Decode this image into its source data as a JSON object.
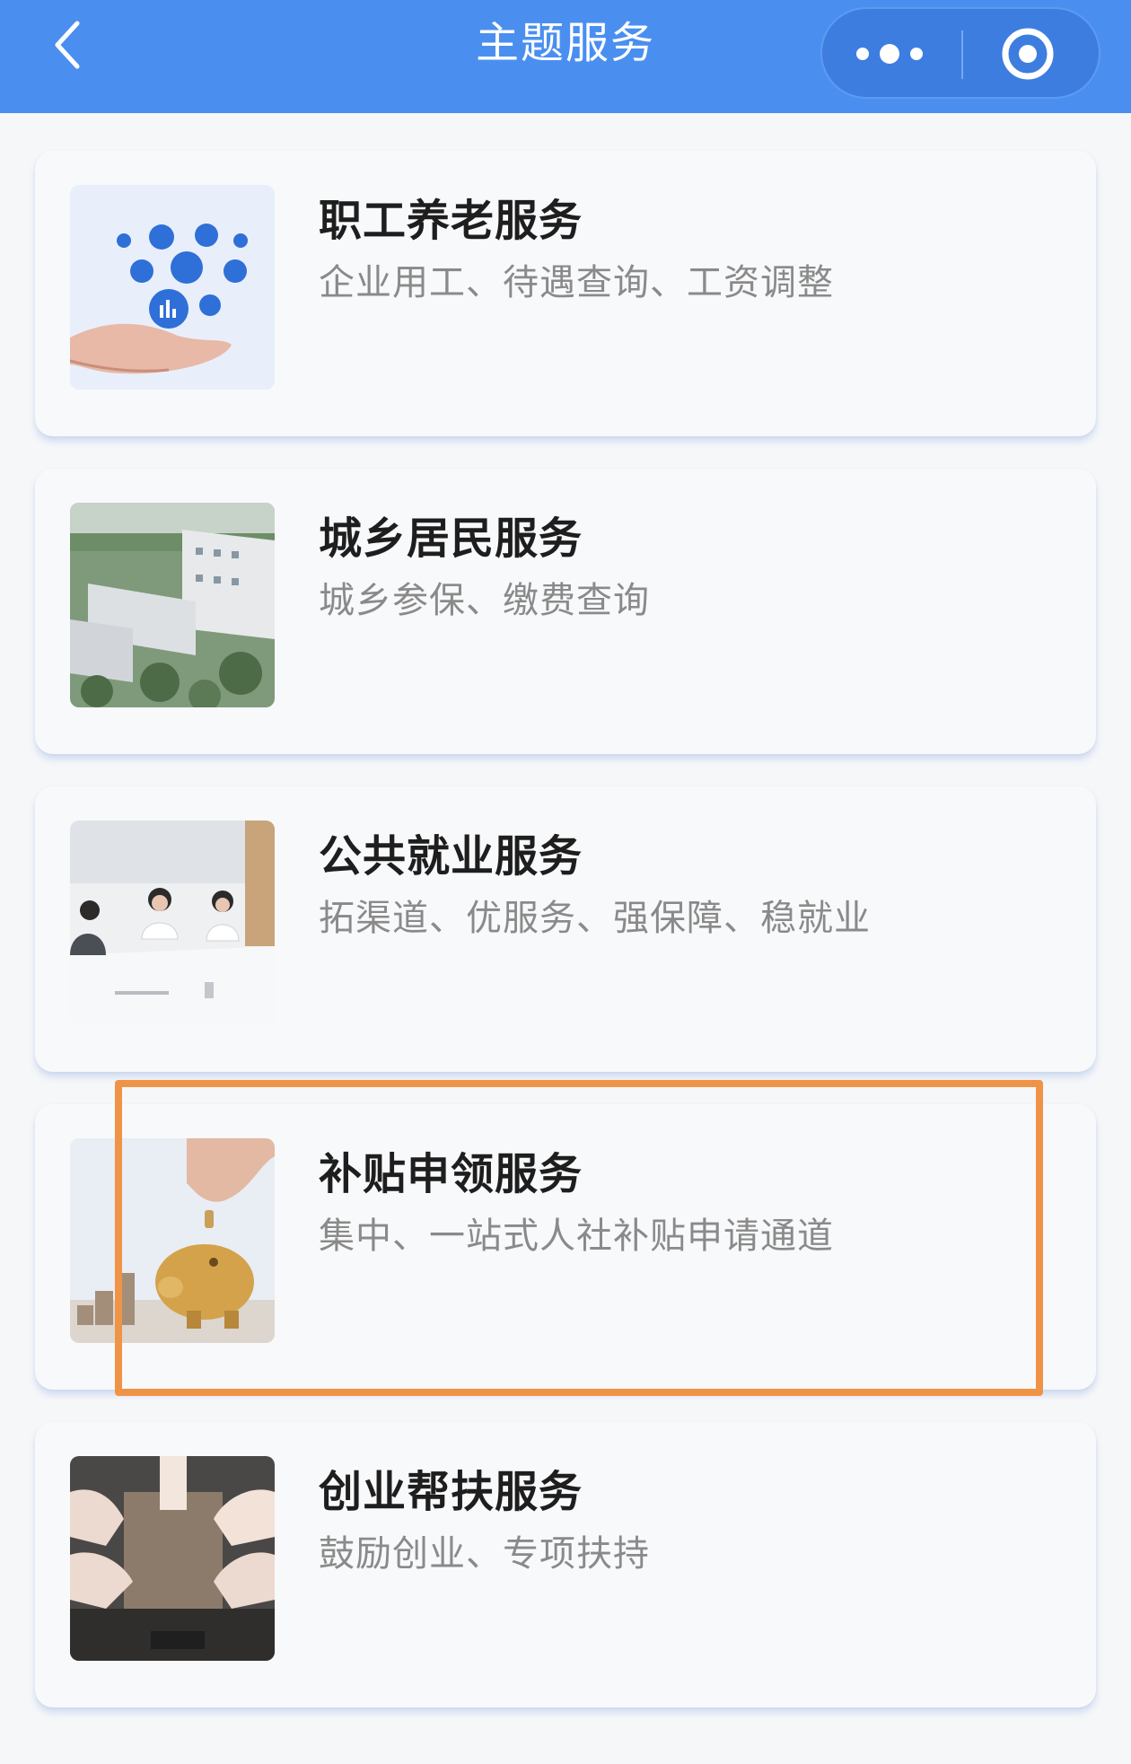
{
  "nav": {
    "title": "主题服务",
    "back_icon": "chevron-left-icon",
    "more_icon": "more-dots-icon",
    "close_icon": "target-circle-icon",
    "background_color": "#4a8ff0"
  },
  "services": [
    {
      "title": "职工养老服务",
      "subtitle": "企业用工、待遇查询、工资调整",
      "image": "hand-holding-service-icons"
    },
    {
      "title": "城乡居民服务",
      "subtitle": "城乡参保、缴费查询",
      "image": "aerial-building-photo"
    },
    {
      "title": "公共就业服务",
      "subtitle": "拓渠道、优服务、强保障、稳就业",
      "image": "meeting-room-photo"
    },
    {
      "title": "补贴申领服务",
      "subtitle": "集中、一站式人社补贴申请通道",
      "image": "piggy-bank-coin-photo"
    },
    {
      "title": "创业帮扶服务",
      "subtitle": "鼓励创业、专项扶持",
      "image": "thumbs-up-team-photo"
    }
  ],
  "highlight_color": "#ef9446"
}
